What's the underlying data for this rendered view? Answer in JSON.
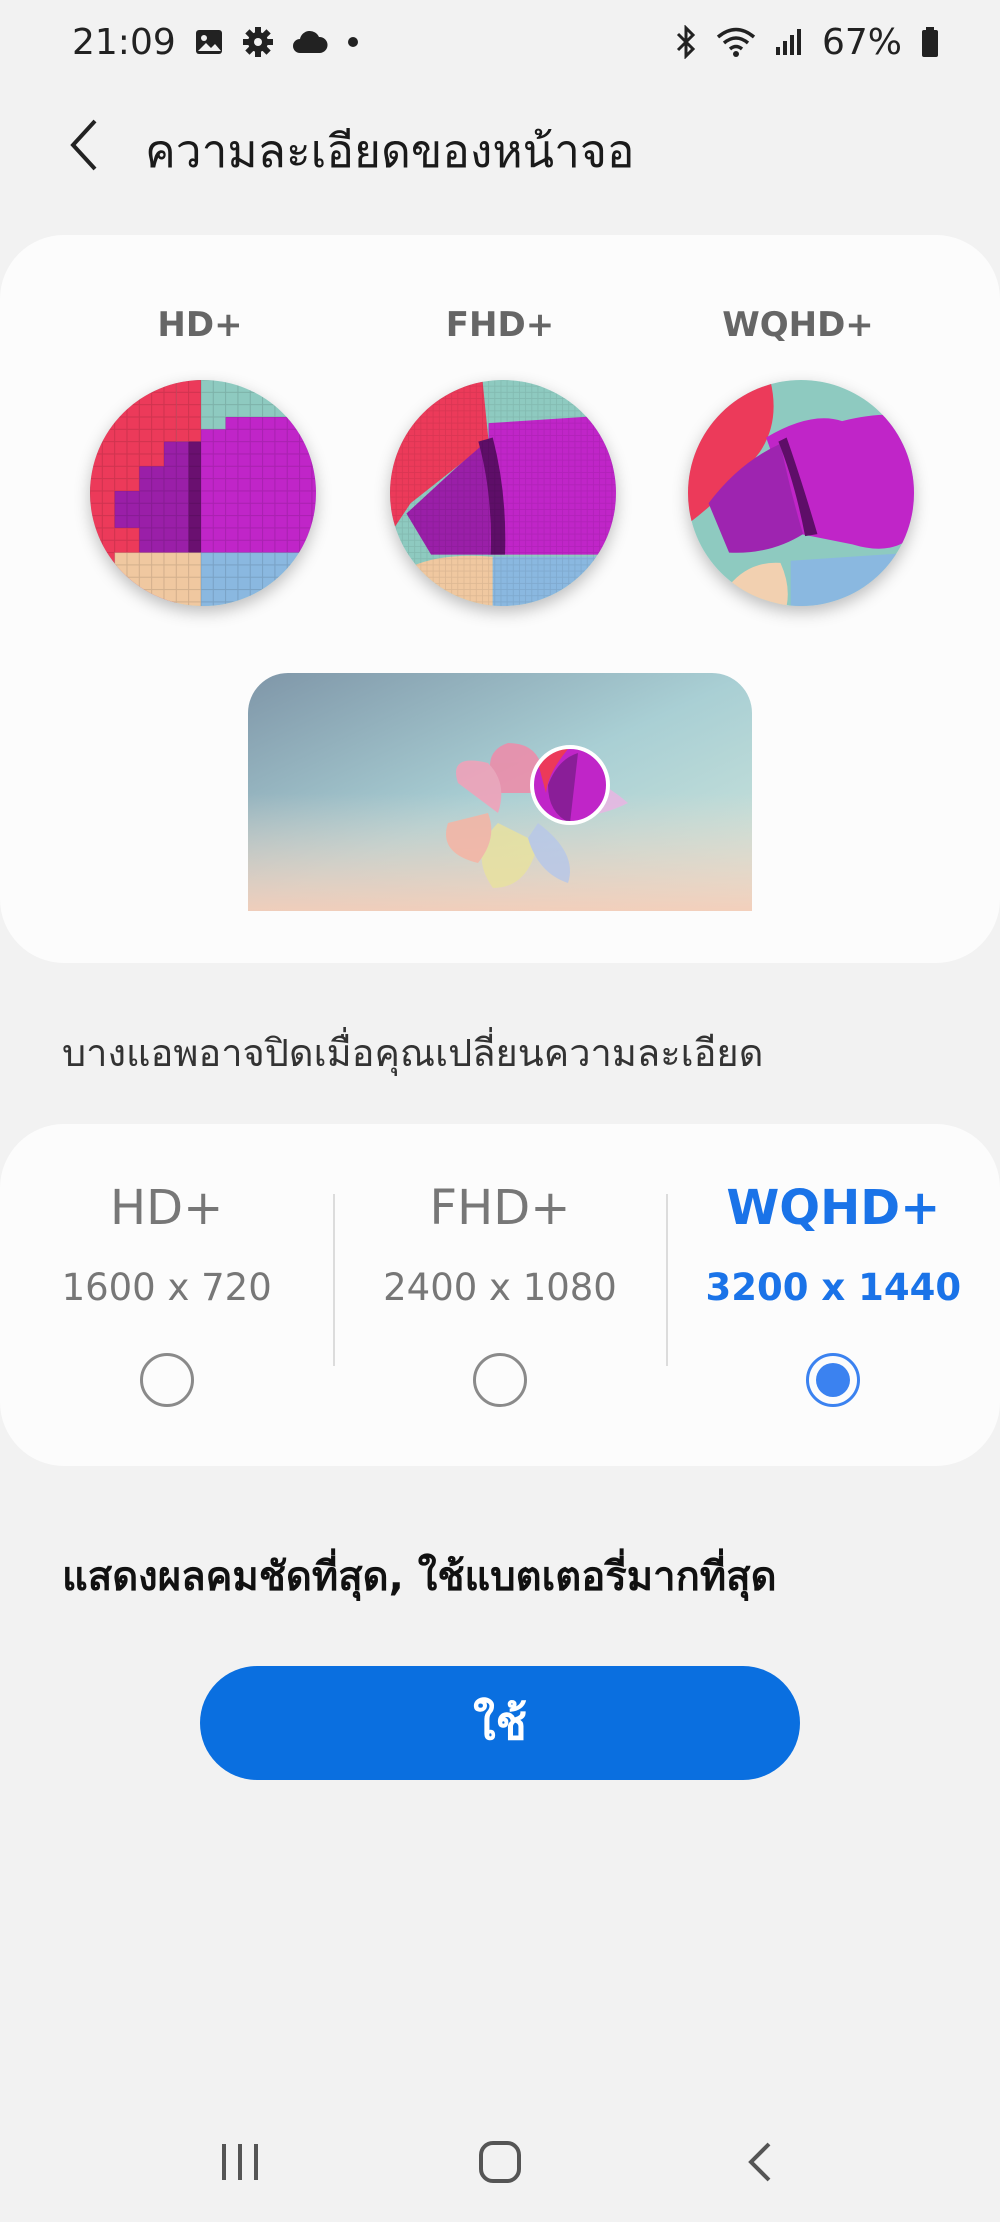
{
  "status_bar": {
    "time": "21:09",
    "battery": "67%",
    "left_icons": [
      "gallery-icon",
      "settings-icon",
      "cloud-icon",
      "dot-icon"
    ],
    "right_icons": [
      "bluetooth-icon",
      "wifi-icon",
      "signal-icon",
      "battery-icon"
    ]
  },
  "header": {
    "title": "ความละเอียดของหน้าจอ"
  },
  "preview": {
    "labels": [
      "HD+",
      "FHD+",
      "WQHD+"
    ]
  },
  "note": "บางแอพอาจปิดเมื่อคุณเปลี่ยนความละเอียด",
  "options": [
    {
      "name": "HD+",
      "resolution": "1600 x 720",
      "selected": false
    },
    {
      "name": "FHD+",
      "resolution": "2400 x 1080",
      "selected": false
    },
    {
      "name": "WQHD+",
      "resolution": "3200 x 1440",
      "selected": true
    }
  ],
  "description": "แสดงผลคมชัดที่สุด, ใช้แบตเตอรี่มากที่สุด",
  "apply_label": "ใช้",
  "colors": {
    "accent": "#1a73e8",
    "button": "#0a6fe0",
    "background": "#f2f2f2",
    "card": "#fcfcfc"
  },
  "nav_bar": [
    "recents-icon",
    "home-icon",
    "back-icon"
  ]
}
